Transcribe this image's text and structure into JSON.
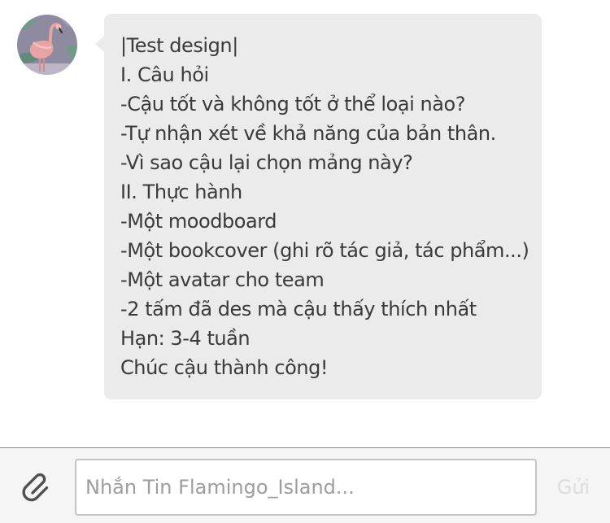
{
  "message": {
    "sender_avatar": "flamingo-avatar",
    "lines": [
      "|Test design|",
      "I. Câu hỏi",
      "-Cậu tốt và không tốt ở thể loại nào?",
      "-Tự nhận xét về khả năng của bản thân.",
      "-Vì sao cậu lại chọn mảng này?",
      "II. Thực hành",
      "-Một moodboard",
      "-Một bookcover (ghi rõ tác giả, tác phẩm...)",
      "-Một avatar cho team",
      "-2 tấm đã des mà cậu thấy thích nhất",
      "Hạn: 3-4 tuần",
      "Chúc cậu thành công!"
    ]
  },
  "composer": {
    "attach_icon": "paperclip-icon",
    "input_value": "",
    "input_placeholder": "Nhắn Tin Flamingo_Island...",
    "send_label": "Gửi"
  },
  "colors": {
    "bubble": "#ebebeb",
    "text": "#3a3a3a",
    "composer_bg": "#f5f5f5",
    "placeholder": "#9d9d9d",
    "send_disabled": "#dcdcdc"
  }
}
